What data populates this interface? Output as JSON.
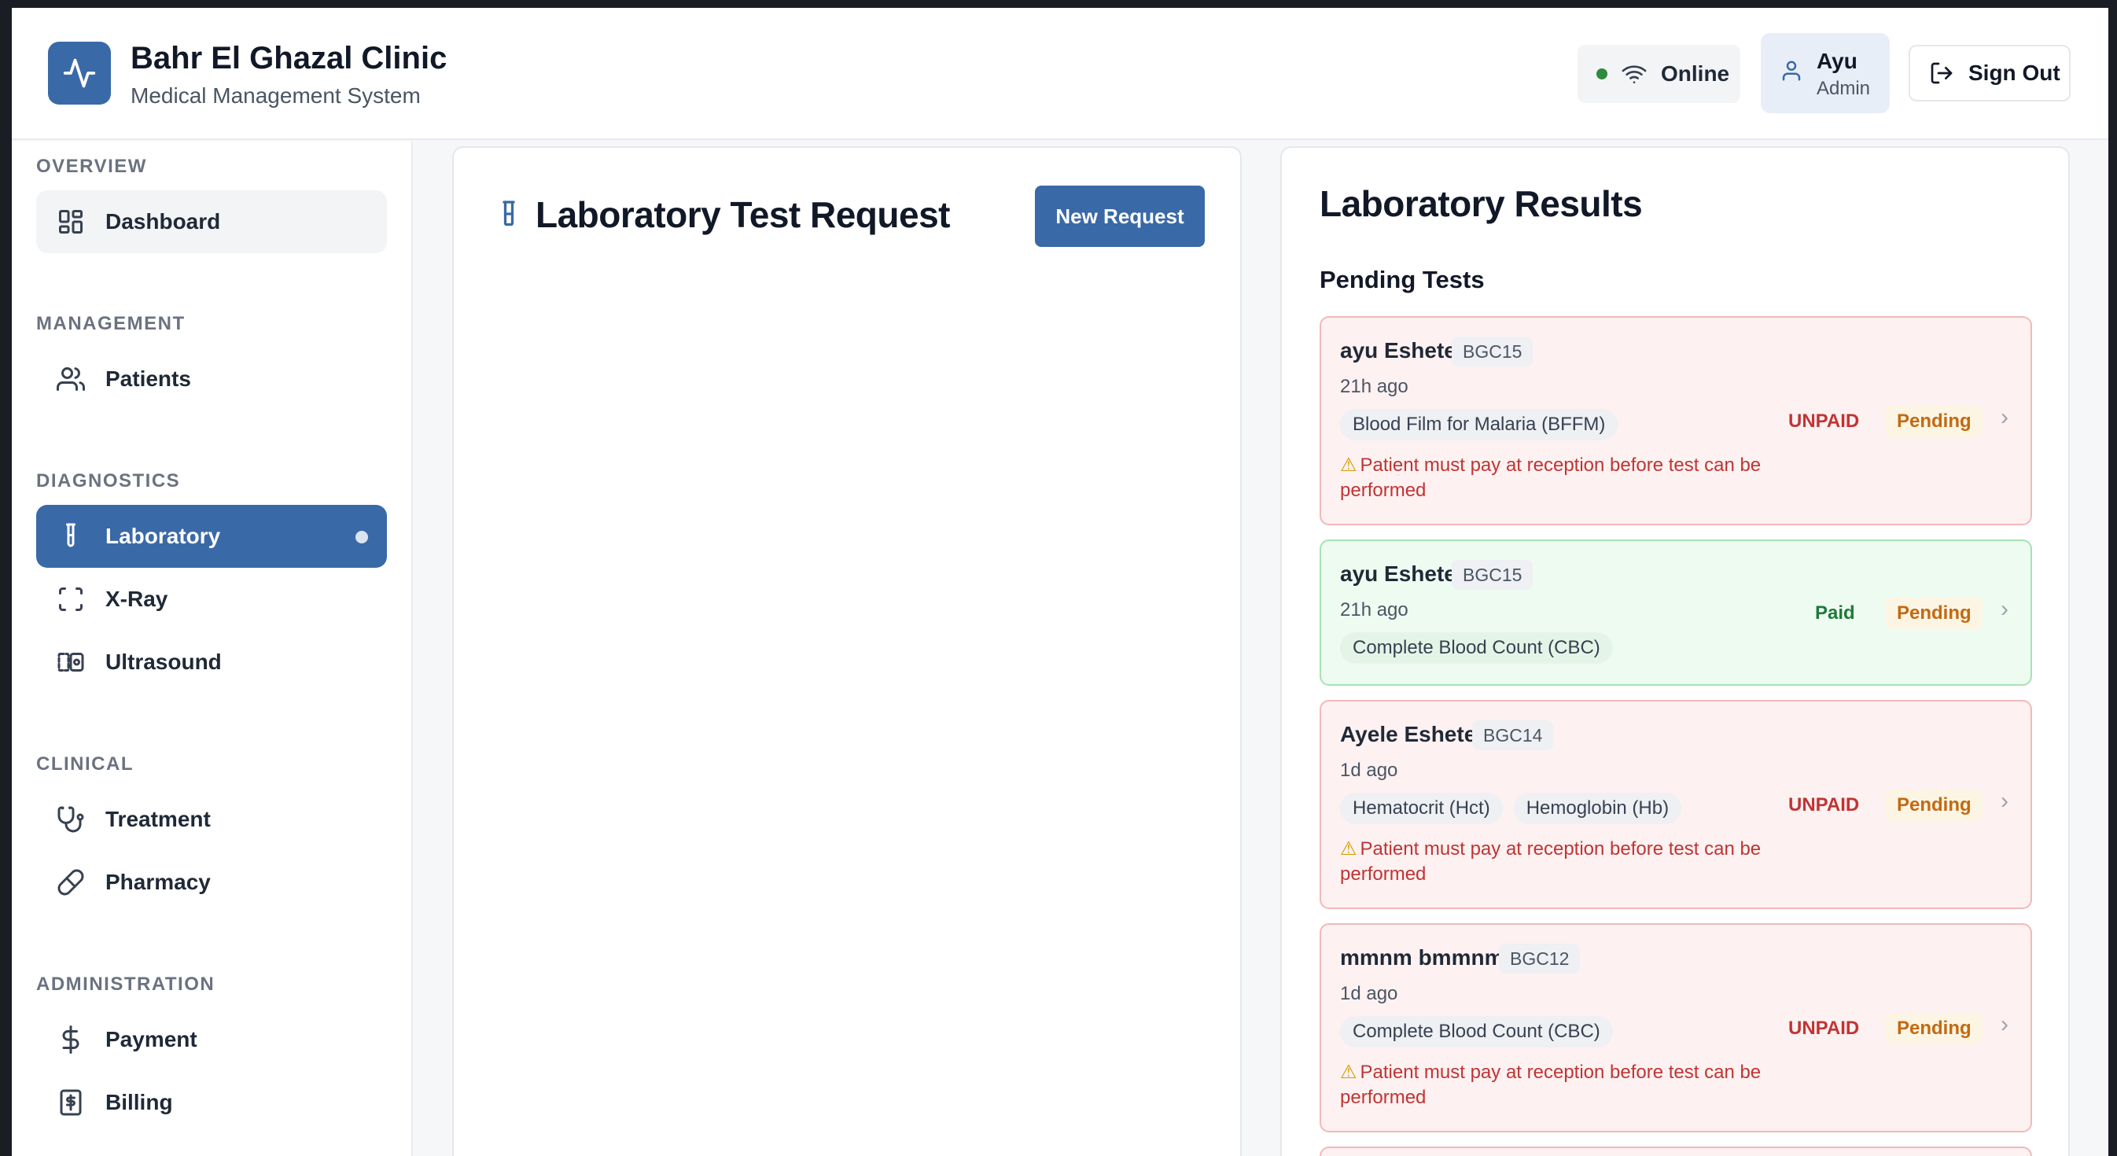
{
  "header": {
    "title": "Bahr El Ghazal Clinic",
    "subtitle": "Medical Management System",
    "status": "Online",
    "user_name": "Ayu",
    "user_role": "Admin",
    "signout_label": "Sign Out"
  },
  "sidebar": {
    "sections": {
      "overview": "OVERVIEW",
      "management": "MANAGEMENT",
      "diagnostics": "DIAGNOSTICS",
      "clinical": "CLINICAL",
      "administration": "ADMINISTRATION"
    },
    "items": {
      "dashboard": "Dashboard",
      "patients": "Patients",
      "laboratory": "Laboratory",
      "xray": "X-Ray",
      "ultrasound": "Ultrasound",
      "treatment": "Treatment",
      "pharmacy": "Pharmacy",
      "payment": "Payment",
      "billing": "Billing"
    }
  },
  "request": {
    "title": "Laboratory Test Request",
    "new_label": "New Request"
  },
  "results": {
    "title": "Laboratory Results",
    "pending_title": "Pending Tests",
    "cards": [
      {
        "name": "ayu Eshete",
        "id": "BGC15",
        "ago": "21h ago",
        "tests": [
          "Blood Film for Malaria (BFFM)"
        ],
        "warning": "Patient must pay at reception before test can be performed",
        "payment": "UNPAID",
        "status": "Pending"
      },
      {
        "name": "ayu Eshete",
        "id": "BGC15",
        "ago": "21h ago",
        "tests": [
          "Complete Blood Count (CBC)"
        ],
        "payment": "Paid",
        "status": "Pending"
      },
      {
        "name": "Ayele Eshete",
        "id": "BGC14",
        "ago": "1d ago",
        "tests": [
          "Hematocrit (Hct)",
          "Hemoglobin (Hb)"
        ],
        "warning": "Patient must pay at reception before test can be performed",
        "payment": "UNPAID",
        "status": "Pending"
      },
      {
        "name": "mmnm bmmnm",
        "id": "BGC12",
        "ago": "1d ago",
        "tests": [
          "Complete Blood Count (CBC)"
        ],
        "warning": "Patient must pay at reception before test can be performed",
        "payment": "UNPAID",
        "status": "Pending"
      }
    ]
  },
  "colors": {
    "primary": "#3a69a8",
    "online": "#2f8a3c",
    "unpaid": "#c03434",
    "paid": "#1f7a3a",
    "pending": "#c26a12"
  },
  "icons": {
    "logo": "activity-icon",
    "status": "wifi-icon",
    "user": "user-icon",
    "signout": "log-out-icon",
    "request": "test-tube-icon"
  }
}
